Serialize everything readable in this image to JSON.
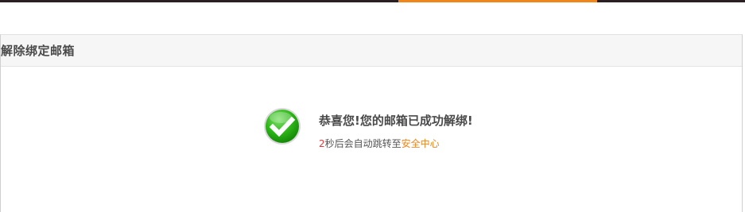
{
  "colors": {
    "top_bar": "#2a1f22",
    "accent": "#f08519",
    "countdown": "#e4393c",
    "success": "#22a60f"
  },
  "panel": {
    "title": "解除绑定邮箱"
  },
  "result": {
    "icon": "check-circle-icon",
    "title": "恭喜您!您的邮箱已成功解绑!",
    "countdown": "2",
    "redirect_text": "秒后会自动跳转至",
    "link_text": "安全中心"
  }
}
